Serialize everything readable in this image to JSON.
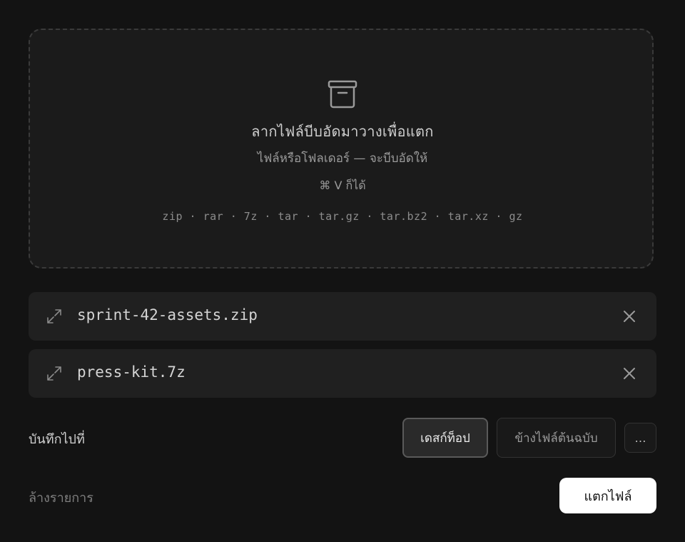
{
  "dropzone": {
    "icon": "archive-box-icon",
    "title": "ลากไฟล์บีบอัดมาวางเพื่อแตก",
    "subtitle": "ไฟล์หรือโฟลเดอร์ — จะบีบอัดให้",
    "paste_hint": "⌘ V ก็ได้",
    "formats": "zip · rar · 7z · tar · tar.gz · tar.bz2 · tar.xz · gz"
  },
  "files": [
    {
      "name": "sprint-42-assets.zip",
      "icon": "expand-icon",
      "remove_icon": "close-icon"
    },
    {
      "name": "press-kit.7z",
      "icon": "expand-icon",
      "remove_icon": "close-icon"
    }
  ],
  "destination": {
    "label": "บันทึกไปที่",
    "options": [
      "เดสก์ท็อป",
      "ข้างไฟล์ต้นฉบับ"
    ],
    "selected": "เดสก์ท็อป",
    "more_label": "…"
  },
  "actions": {
    "clear_label": "ล้างรายการ",
    "extract_label": "แตกไฟล์"
  },
  "colors": {
    "background": "#131313",
    "dropzone_bg": "#1b1b1b",
    "row_bg": "#202020",
    "primary_button": "#ffffff"
  }
}
